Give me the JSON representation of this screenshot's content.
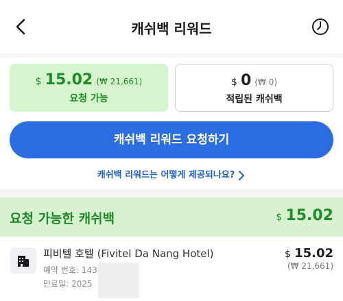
{
  "header": {
    "title": "캐쉬백 리워드",
    "back_icon": "chevron-left-icon",
    "history_icon": "clock-icon"
  },
  "summary": {
    "available": {
      "currency": "$",
      "amount": "15.02",
      "krw": "(₩ 21,661)",
      "label": "요청 가능"
    },
    "earned": {
      "currency": "$",
      "amount": "0",
      "krw": "(₩ 0)",
      "label": "적립된 캐쉬백"
    }
  },
  "request_button": {
    "label": "캐쉬백 리워드 요청하기"
  },
  "howto_link": {
    "label": "캐쉬백 리워드는 어떻게 제공되나요?"
  },
  "section": {
    "title": "요청 가능한 캐쉬백",
    "currency": "$",
    "total": "15.02"
  },
  "bookings": [
    {
      "name_ko": "피비텔 호텔",
      "name_en": "(Fivitel Da Nang Hotel)",
      "booking_no": "예약 번호: 143",
      "expiry": "만료일: 2025",
      "currency": "$",
      "amount": "15.02",
      "krw": "(₩ 21,661)",
      "icon": "hotel-icon"
    }
  ],
  "colors": {
    "accent_blue": "#2c6ee0",
    "green_text": "#1e8a2c",
    "green_bg": "#d6f5cd"
  }
}
